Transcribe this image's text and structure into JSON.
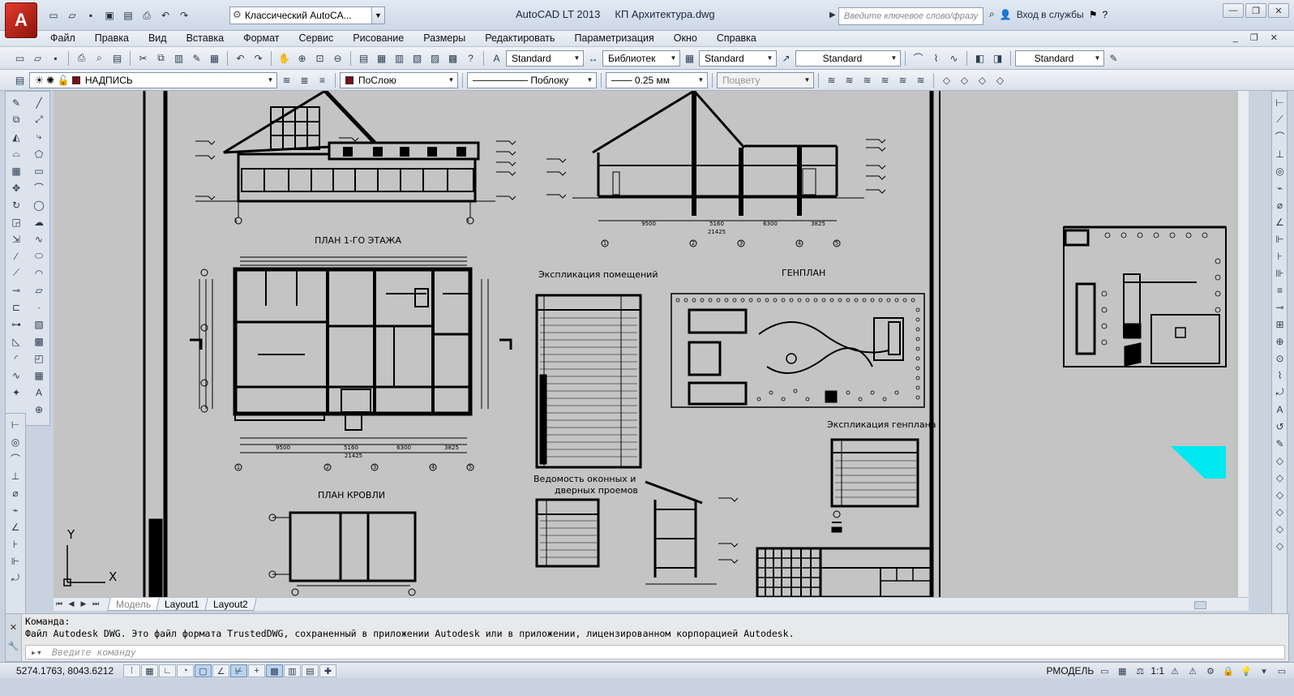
{
  "title": {
    "app": "AutoCAD LT 2013",
    "file": "КП Архитектура.dwg",
    "workspace": "Классический AutoCA...",
    "search_placeholder": "Введите ключевое слово/фразу",
    "signin": "Вход в службы"
  },
  "menu": [
    "Файл",
    "Правка",
    "Вид",
    "Вставка",
    "Формат",
    "Сервис",
    "Рисование",
    "Размеры",
    "Редактировать",
    "Параметризация",
    "Окно",
    "Справка"
  ],
  "styles_toolbar": {
    "text_style": "Standard",
    "dim_style": "Библиотек",
    "table_style": "Standard",
    "mleader_style": "Standard",
    "visual_style": "Standard"
  },
  "layers_toolbar": {
    "layer": "НАДПИСЬ",
    "color": "ПоСлою",
    "linetype": "Поблоку",
    "lineweight": "0.25 мм",
    "plotstyle": "Поцвету"
  },
  "drawing": {
    "plan1_title": "ПЛАН 1-ГО ЭТАЖА",
    "roof_title": "ПЛАН КРОВЛИ",
    "rooms_title": "Экспликация помещений",
    "genplan_title": "ГЕНПЛАН",
    "genplan_expl_title": "Экспликация генплана",
    "windows_title_1": "Ведомость оконных и",
    "windows_title_2": "дверных проемов",
    "ucs_x": "X",
    "ucs_y": "Y",
    "axis_labels": [
      "1",
      "2",
      "3",
      "4",
      "5"
    ],
    "dims": [
      "9500",
      "5160",
      "6300",
      "3825",
      "21425"
    ]
  },
  "tabs": [
    "Модель",
    "Layout1",
    "Layout2"
  ],
  "command": {
    "label": "Команда:",
    "message": "Файл Autodesk DWG. Это файл формата TrustedDWG, сохраненный в приложении Autodesk или в приложении, лицензированном корпорацией Autodesk.",
    "placeholder": "Введите команду"
  },
  "status": {
    "coords": "5274.1763, 8043.6212",
    "space": "РМОДЕЛЬ",
    "scale": "1:1"
  },
  "colors": {
    "accent_red": "#c62a1d",
    "canvas_bg": "#c4c4c4",
    "cyan_object": "#00e8f0"
  }
}
